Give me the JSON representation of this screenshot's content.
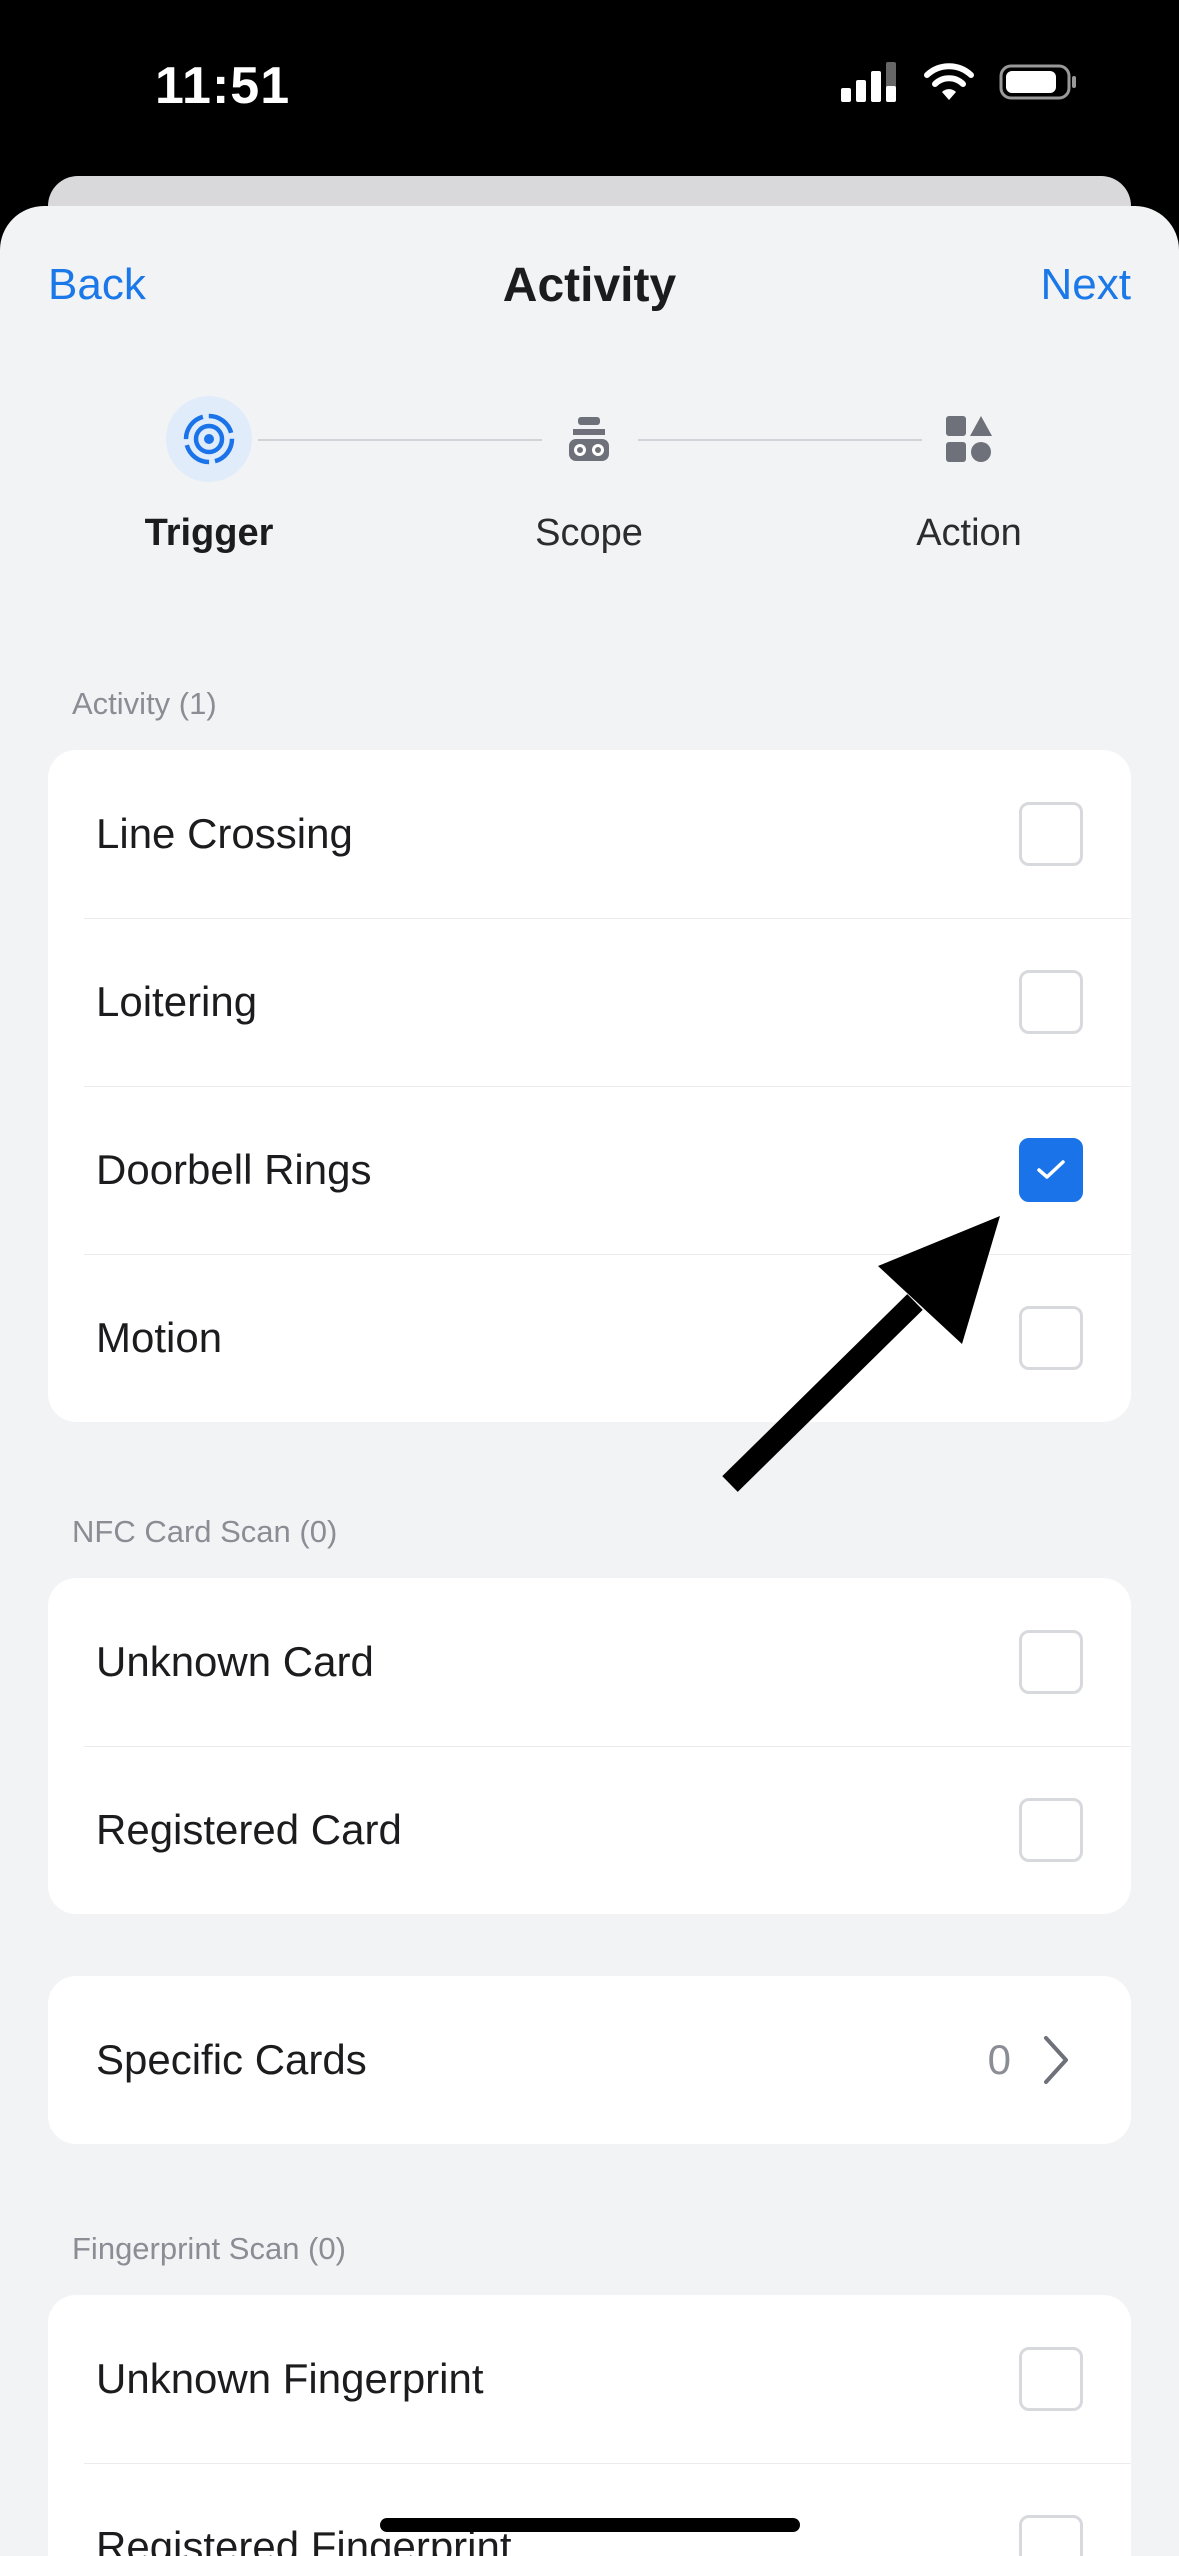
{
  "status_bar": {
    "time": "11:51"
  },
  "nav": {
    "back_label": "Back",
    "title": "Activity",
    "next_label": "Next"
  },
  "steps": [
    {
      "label": "Trigger",
      "icon": "target-icon",
      "active": true
    },
    {
      "label": "Scope",
      "icon": "scope-icon",
      "active": false
    },
    {
      "label": "Action",
      "icon": "shapes-icon",
      "active": false
    }
  ],
  "sections": {
    "activity": {
      "header": "Activity (1)",
      "items": [
        {
          "label": "Line Crossing",
          "checked": false
        },
        {
          "label": "Loitering",
          "checked": false
        },
        {
          "label": "Doorbell Rings",
          "checked": true
        },
        {
          "label": "Motion",
          "checked": false
        }
      ]
    },
    "nfc": {
      "header": "NFC Card Scan (0)",
      "items": [
        {
          "label": "Unknown Card",
          "checked": false
        },
        {
          "label": "Registered Card",
          "checked": false
        }
      ]
    },
    "specific_cards": {
      "label": "Specific Cards",
      "value": "0"
    },
    "fingerprint": {
      "header": "Fingerprint Scan (0)",
      "items": [
        {
          "label": "Unknown Fingerprint",
          "checked": false
        },
        {
          "label": "Registered Fingerprint",
          "checked": false
        }
      ]
    }
  },
  "colors": {
    "accent": "#1a73e8",
    "link": "#1a78e8",
    "background": "#f2f3f5"
  }
}
